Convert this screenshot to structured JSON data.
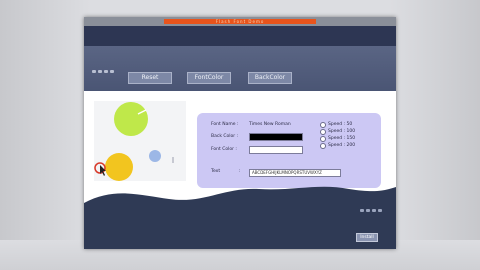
{
  "window": {
    "title": "Flash Font Demo"
  },
  "toolbar": {
    "buttons": [
      {
        "label": "Reset"
      },
      {
        "label": "FontColor"
      },
      {
        "label": "BackColor"
      }
    ]
  },
  "form": {
    "font_name_label": "Font Name :",
    "font_name_value": "Times New Roman",
    "back_color_label": "Back Color :",
    "font_color_label": "Font Color :",
    "text_label": "Text",
    "text_value": "ABCDEFGHIJKLMNOPQRSTUVWXYZ",
    "speed_options": [
      "Speed : 50",
      "Speed : 100",
      "Speed : 150",
      "Speed : 200"
    ]
  },
  "footer": {
    "button_label": "Install"
  },
  "colors": {
    "back_color": "#000000",
    "font_color": "#ffffff",
    "accent": "#e8541c",
    "panel": "#ccc8f4"
  }
}
